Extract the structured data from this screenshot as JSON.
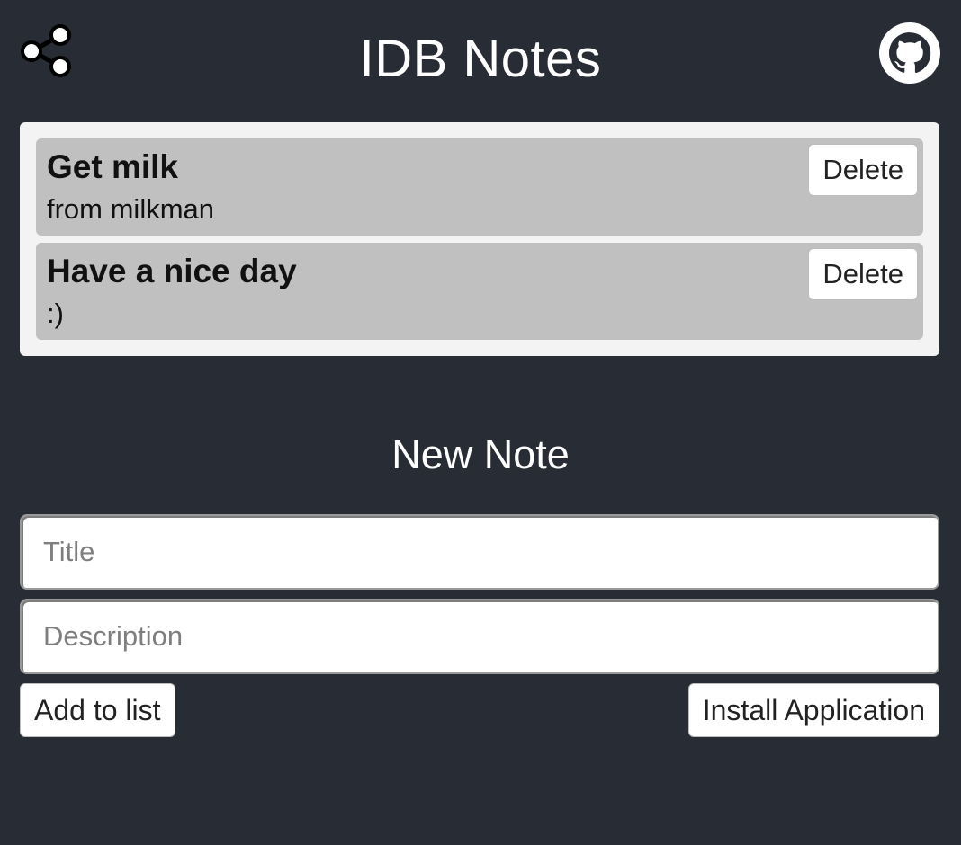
{
  "header": {
    "title": "IDB Notes",
    "share_icon": "share-icon",
    "github_icon": "github-icon"
  },
  "notes": [
    {
      "title": "Get milk",
      "description": "from milkman",
      "delete_label": "Delete"
    },
    {
      "title": "Have a nice day",
      "description": ":)",
      "delete_label": "Delete"
    }
  ],
  "form": {
    "heading": "New Note",
    "title_placeholder": "Title",
    "title_value": "",
    "description_placeholder": "Description",
    "description_value": "",
    "add_label": "Add to list",
    "install_label": "Install Application"
  },
  "colors": {
    "background": "#282c35",
    "panel": "#f3f3f3",
    "note_card": "#c0c0c0",
    "title_text": "#ffffff"
  }
}
